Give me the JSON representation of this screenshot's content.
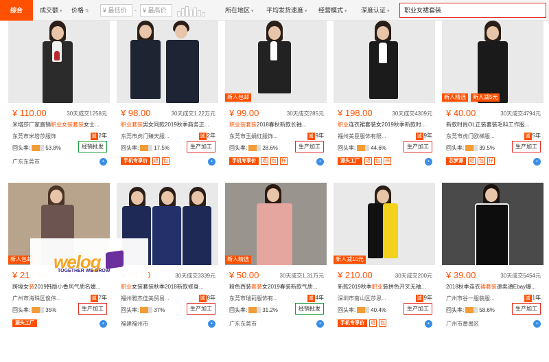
{
  "toolbar": {
    "sort_default": "综合",
    "sort_volume": "成交额",
    "sort_price": "价格",
    "price_min_placeholder": "最低价",
    "price_dash": "-",
    "price_max_placeholder": "最高价",
    "region": "所在地区",
    "ship_speed": "平均发货速度",
    "biz_mode": "经营模式",
    "certified": "深度认证",
    "search_value": "职业女裙套装"
  },
  "products": [
    {
      "price": "¥ 110.00",
      "sold": "30天成交1258元",
      "title_pre": "米塔莎厂家直销",
      "title_hl": "职业女装套装",
      "title_post": "女士...",
      "shop": "东莞市米塔莎服饰",
      "years": "2年",
      "rate": "53.8%",
      "biz": "经销批发",
      "biz_green": true,
      "location": "广东东莞市",
      "tags": []
    },
    {
      "price": "¥ 98.00",
      "sold": "30天成交1.22万元",
      "title_pre": "",
      "title_hl": "职业套装",
      "title_post": "男女同款2019秋季商务正...",
      "shop": "东莞市虎门臻天服...",
      "years": "2年",
      "rate": "17.5%",
      "biz": "生产加工",
      "biz_green": false,
      "location": "",
      "tags": [
        "手机专享价"
      ]
    },
    {
      "price": "¥ 99.00",
      "sold": "30天成交285元",
      "title_pre": "",
      "title_hl": "职业装套装",
      "title_post": "2018春秋新款长袖...",
      "shop": "东莞市玉娟红服饰...",
      "years": "9年",
      "rate": "28.6%",
      "biz": "生产加工",
      "biz_green": false,
      "location": "",
      "tags": [
        "手机专享价"
      ],
      "photo_tag": "新人包邮"
    },
    {
      "price": "¥ 198.00",
      "sold": "30天成交4309元",
      "title_pre": "",
      "title_hl": "职业",
      "title_post": "连衣裙套装女2019秋季新款时...",
      "shop": "福州美臣服饰有限...",
      "years": "9年",
      "rate": "44.6%",
      "biz": "生产加工",
      "biz_green": false,
      "location": "",
      "tags": [
        "源头工厂"
      ]
    },
    {
      "price": "¥ 40.00",
      "sold": "30天成交4794元",
      "title_pre": "新款时尚OL正装",
      "title_hl": "",
      "title_post": "套装毛料工作服...",
      "shop": "东莞市虎门欧梯服...",
      "years": "5年",
      "rate": "39.5%",
      "biz": "生产加工",
      "biz_green": false,
      "location": "",
      "tags": [
        "芯梦源"
      ],
      "photo_tag": "新人精选",
      "photo_tag2": "新人减5元"
    },
    {
      "price": "¥ 212.00",
      "sold": "30天成交1269元",
      "title_pre": "跨境女",
      "title_hl": "装",
      "title_post": "2019韩版小香风气质名媛...",
      "shop": "广州市海珠区俊伟...",
      "years": "7年",
      "rate": "35%",
      "biz": "生产加工",
      "biz_green": false,
      "location": "",
      "tags": [
        "源头工厂"
      ],
      "photo_tag": "新人包邮"
    },
    {
      "price": "¥ 95.00",
      "sold": "30天成交3339元",
      "title_pre": "",
      "title_hl": "职业",
      "title_post": "女装套装秋季2018新款修身...",
      "shop": "福州雅杰佳美贸易...",
      "years": "8年",
      "rate": "37%",
      "biz": "生产加工",
      "biz_green": false,
      "location": "福建福州市",
      "tags": []
    },
    {
      "price": "¥ 50.00",
      "sold": "30天成交1.31万元",
      "title_pre": "粉色西装",
      "title_hl": "套装",
      "title_post": "女2019春装新款气质...",
      "shop": "东莞市瑞莉服饰有...",
      "years": "4年",
      "rate": "31.2%",
      "biz": "经销批发",
      "biz_green": true,
      "location": "广东东莞市",
      "tags": [],
      "photo_tag": "新人精选"
    },
    {
      "price": "¥ 210.00",
      "sold": "30天成交200元",
      "title_pre": "新款2019秋季",
      "title_hl": "职业",
      "title_post": "装拼色开叉无袖...",
      "shop": "深圳市南山区莎思...",
      "years": "9年",
      "rate": "40.4%",
      "biz": "生产加工",
      "biz_green": false,
      "location": "",
      "tags": [
        "手机专享价"
      ],
      "photo_tag": "新人减10元"
    },
    {
      "price": "¥ 39.00",
      "sold": "30天成交5454元",
      "title_pre": "2018秋季连衣",
      "title_hl": "裙套装",
      "title_post": "速卖通Ebay爆...",
      "shop": "广州市谷一服装服...",
      "years": "1年",
      "rate": "58.6%",
      "biz": "生产加工",
      "biz_green": false,
      "location": "广州市番禺区",
      "tags": []
    }
  ],
  "logo": {
    "name": "welog",
    "tagline": "TOGETHER WE GROW"
  },
  "rate_label": "回头率:",
  "colors": {
    "accent": "#ff5000",
    "search_border": "#e02e24",
    "biz_red": "#e02e24",
    "biz_green": "#1a9a3a"
  }
}
